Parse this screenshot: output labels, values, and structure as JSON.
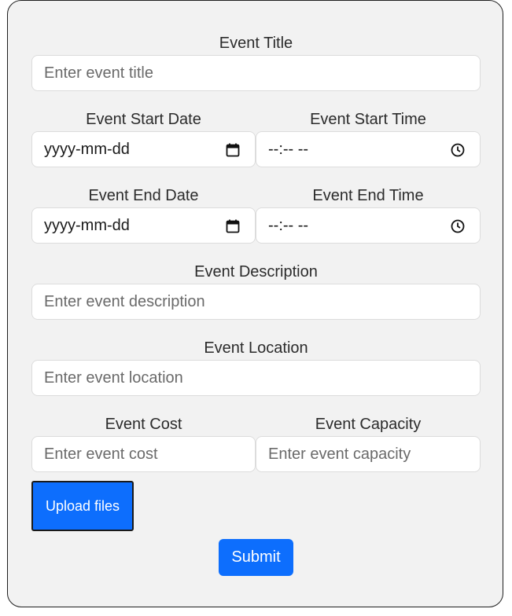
{
  "form": {
    "title": {
      "label": "Event Title",
      "placeholder": "Enter event title"
    },
    "start_date": {
      "label": "Event Start Date",
      "value": "yyyy-mm-dd"
    },
    "start_time": {
      "label": "Event Start Time",
      "value": "--:-- --"
    },
    "end_date": {
      "label": "Event End Date",
      "value": "yyyy-mm-dd"
    },
    "end_time": {
      "label": "Event End Time",
      "value": "--:-- --"
    },
    "description": {
      "label": "Event Description",
      "placeholder": "Enter event description"
    },
    "location": {
      "label": "Event Location",
      "placeholder": "Enter event location"
    },
    "cost": {
      "label": "Event Cost",
      "placeholder": "Enter event cost"
    },
    "capacity": {
      "label": "Event Capacity",
      "placeholder": "Enter event capacity"
    },
    "upload_label": "Upload files",
    "submit_label": "Submit"
  },
  "icons": {
    "date": "calendar-icon",
    "time": "clock-icon"
  },
  "colors": {
    "primary": "#0d6efd",
    "card_bg": "#f2f2f2"
  }
}
